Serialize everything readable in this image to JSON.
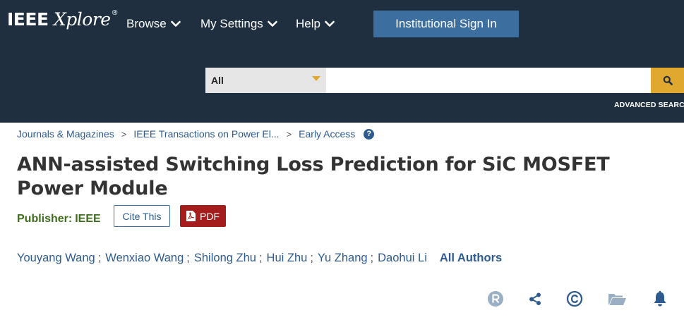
{
  "header": {
    "logo_brand": "IEEE",
    "logo_product": "Xplore",
    "logo_mark": "®",
    "nav": [
      {
        "label": "Browse"
      },
      {
        "label": "My Settings"
      },
      {
        "label": "Help"
      }
    ],
    "signin_label": "Institutional Sign In",
    "search": {
      "scope_value": "All",
      "query_value": "",
      "button_icon": "search-icon"
    },
    "advanced_label": "ADVANCED SEARCH"
  },
  "breadcrumb": [
    {
      "label": "Journals & Magazines"
    },
    {
      "label": "IEEE Transactions on Power El..."
    },
    {
      "label": "Early Access"
    }
  ],
  "breadcrumb_separator": ">",
  "help_icon_glyph": "?",
  "article": {
    "title": "ANN-assisted Switching Loss Prediction for SiC MOSFET Power Module",
    "publisher_label": "Publisher:",
    "publisher_value": "IEEE",
    "cite_label": "Cite This",
    "pdf_label": "PDF"
  },
  "authors": [
    {
      "name": "Youyang Wang"
    },
    {
      "name": "Wenxiao Wang"
    },
    {
      "name": "Shilong Zhu"
    },
    {
      "name": "Hui Zhu"
    },
    {
      "name": "Yu Zhang"
    },
    {
      "name": "Daohui Li"
    }
  ],
  "author_separator": ";",
  "all_authors_label": "All Authors",
  "actions": [
    {
      "icon": "rights-r-icon"
    },
    {
      "icon": "share-icon"
    },
    {
      "icon": "copyright-icon"
    },
    {
      "icon": "folder-icon"
    },
    {
      "icon": "bell-icon"
    }
  ],
  "colors": {
    "header_bg": "#1f2f3f",
    "signin_bg": "#3d6ea0",
    "search_accent": "#e0a82e",
    "link": "#2e5b8f",
    "publisher": "#3f6e1e",
    "pdf_bg": "#a51c1c",
    "action_icon": "#2e5b8f",
    "action_icon_muted": "#9aaec4"
  }
}
